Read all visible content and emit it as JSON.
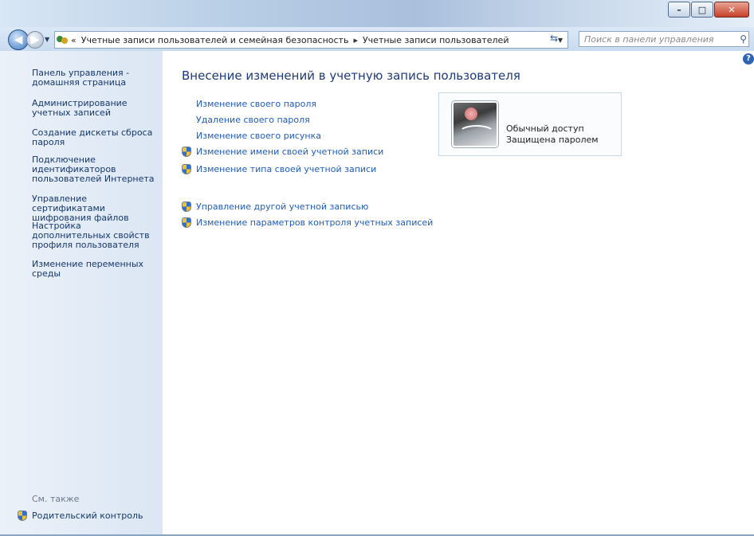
{
  "address": {
    "chevron": "«",
    "crumbs": [
      "Учетные записи пользователей и семейная безопасность",
      "Учетные записи пользователей"
    ],
    "search_placeholder": "Поиск в панели управления"
  },
  "sidebar": {
    "items": [
      {
        "label": "Панель управления - домашняя страница"
      },
      {
        "label": "Администрирование учетных записей"
      },
      {
        "label": "Создание дискеты сброса пароля"
      },
      {
        "label": "Подключение идентификаторов пользователей Интернета"
      },
      {
        "label": "Управление сертификатами шифрования файлов"
      },
      {
        "label": "Настройка дополнительных свойств профиля пользователя"
      },
      {
        "label": "Изменение переменных среды"
      }
    ],
    "see_also": "См. также",
    "parental_control": "Родительский контроль"
  },
  "main": {
    "title": "Внесение изменений в учетную запись пользователя",
    "tasks": [
      {
        "label": "Изменение своего пароля",
        "shield": false
      },
      {
        "label": "Удаление своего пароля",
        "shield": false
      },
      {
        "label": "Изменение своего рисунка",
        "shield": false
      },
      {
        "label": "Изменение имени своей учетной записи",
        "shield": true
      },
      {
        "label": "Изменение типа своей учетной записи",
        "shield": true
      }
    ],
    "other_tasks": [
      {
        "label": "Управление другой учетной записью",
        "shield": true
      },
      {
        "label": "Изменение параметров контроля учетных записей",
        "shield": true
      }
    ]
  },
  "account": {
    "type": "Обычный доступ",
    "status": "Защищена паролем"
  }
}
